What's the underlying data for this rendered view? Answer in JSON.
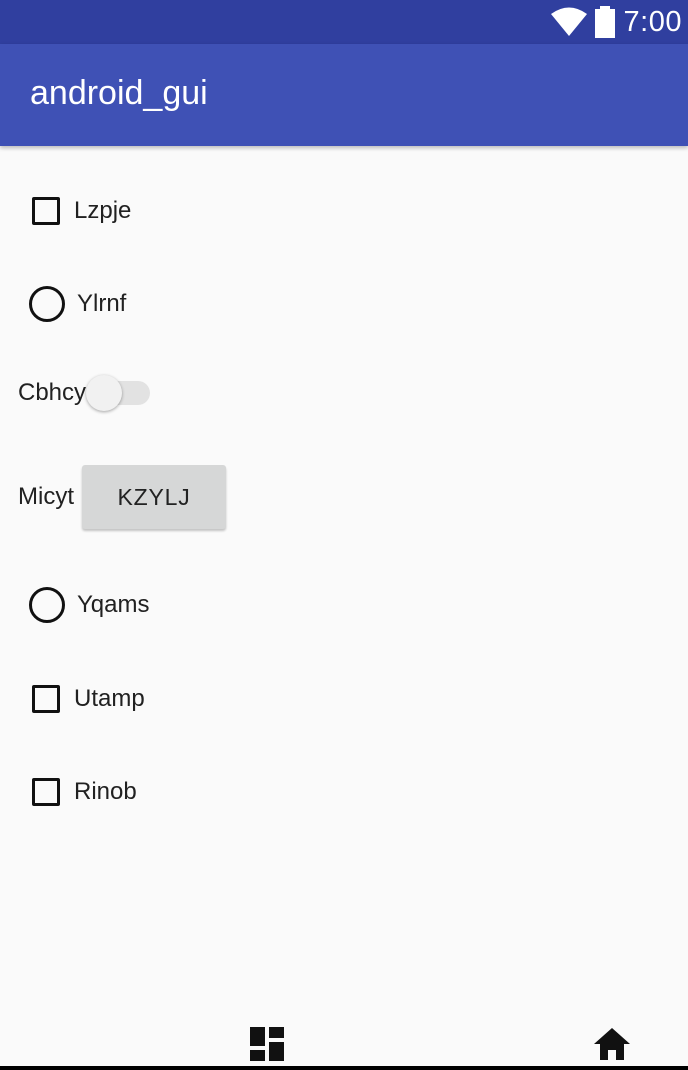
{
  "status_bar": {
    "time": "7:00",
    "icons": [
      "wifi-icon",
      "battery-icon"
    ],
    "color": "#303f9f"
  },
  "app_bar": {
    "title": "android_gui",
    "color": "#3f51b5"
  },
  "widgets": {
    "checkbox_1": {
      "label": "Lzpje",
      "checked": false
    },
    "radio_1": {
      "label": "Ylrnf",
      "selected": false
    },
    "switch_1": {
      "label": "Cbhcy",
      "on": false
    },
    "button_row": {
      "label": "Micyt",
      "button_label": "KZYLJ"
    },
    "radio_2": {
      "label": "Yqams",
      "selected": false
    },
    "checkbox_2": {
      "label": "Utamp",
      "checked": false
    },
    "checkbox_3": {
      "label": "Rinob",
      "checked": false
    }
  },
  "nav_bar": {
    "icons": [
      "dashboard-icon",
      "home-icon"
    ]
  }
}
